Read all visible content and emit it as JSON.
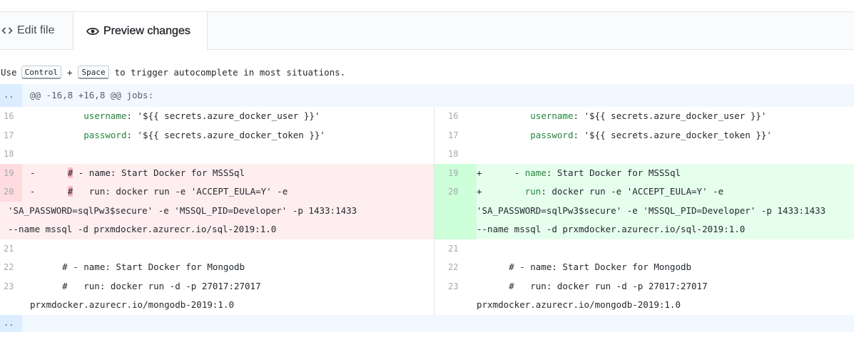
{
  "tabs": {
    "edit": {
      "label": "Edit file",
      "icon": "code-icon"
    },
    "preview": {
      "label": "Preview changes",
      "icon": "eye-icon"
    }
  },
  "hint": {
    "use": "Use",
    "key1": "Control",
    "plus": "+",
    "key2": "Space",
    "rest": "to trigger autocomplete in most situations."
  },
  "diff": {
    "hunk_expand": "..",
    "hunk_header": "@@ -16,8 +16,8 @@ jobs:",
    "bottom_expand": "..",
    "lines": {
      "l16": {
        "num": "16",
        "indent": "          ",
        "key": "username",
        "rest": ": '${{ secrets.azure_docker_user }}'"
      },
      "l17": {
        "num": "17",
        "indent": "          ",
        "key": "password",
        "rest": ": '${{ secrets.azure_docker_token }}'"
      },
      "l18": {
        "num": "18"
      },
      "l19": {
        "num": "19",
        "del_prefix": "-      ",
        "del_hash": "#",
        "del_rest": " - name: Start Docker for MSSSql",
        "add_prefix": "+      ",
        "add_dash": "- ",
        "add_key": "name",
        "add_rest": ": Start Docker for MSSSql"
      },
      "l20": {
        "num": "20",
        "del_prefix": "-      ",
        "del_hash": "#",
        "del_rest": "   run: docker run -e 'ACCEPT_EULA=Y' -e",
        "add_prefix": "+        ",
        "add_key": "run",
        "add_rest": ": docker run -e 'ACCEPT_EULA=Y' -e"
      },
      "l20b": "'SA_PASSWORD=sqlPw3$secure' -e 'MSSQL_PID=Developer' -p 1433:1433",
      "l20c": "--name mssql -d prxmdocker.azurecr.io/sql-2019:1.0",
      "l21": {
        "num": "21"
      },
      "l22": {
        "num": "22",
        "text": "      # - name: Start Docker for Mongodb"
      },
      "l23": {
        "num": "23",
        "text": "      #   run: docker run -d -p 27017:27017"
      },
      "l23b": "prxmdocker.azurecr.io/mongodb-2019:1.0"
    }
  },
  "colors": {
    "del_bg": "#ffeef0",
    "add_bg": "#e6ffed",
    "hunk_bg": "#f1f8ff"
  }
}
